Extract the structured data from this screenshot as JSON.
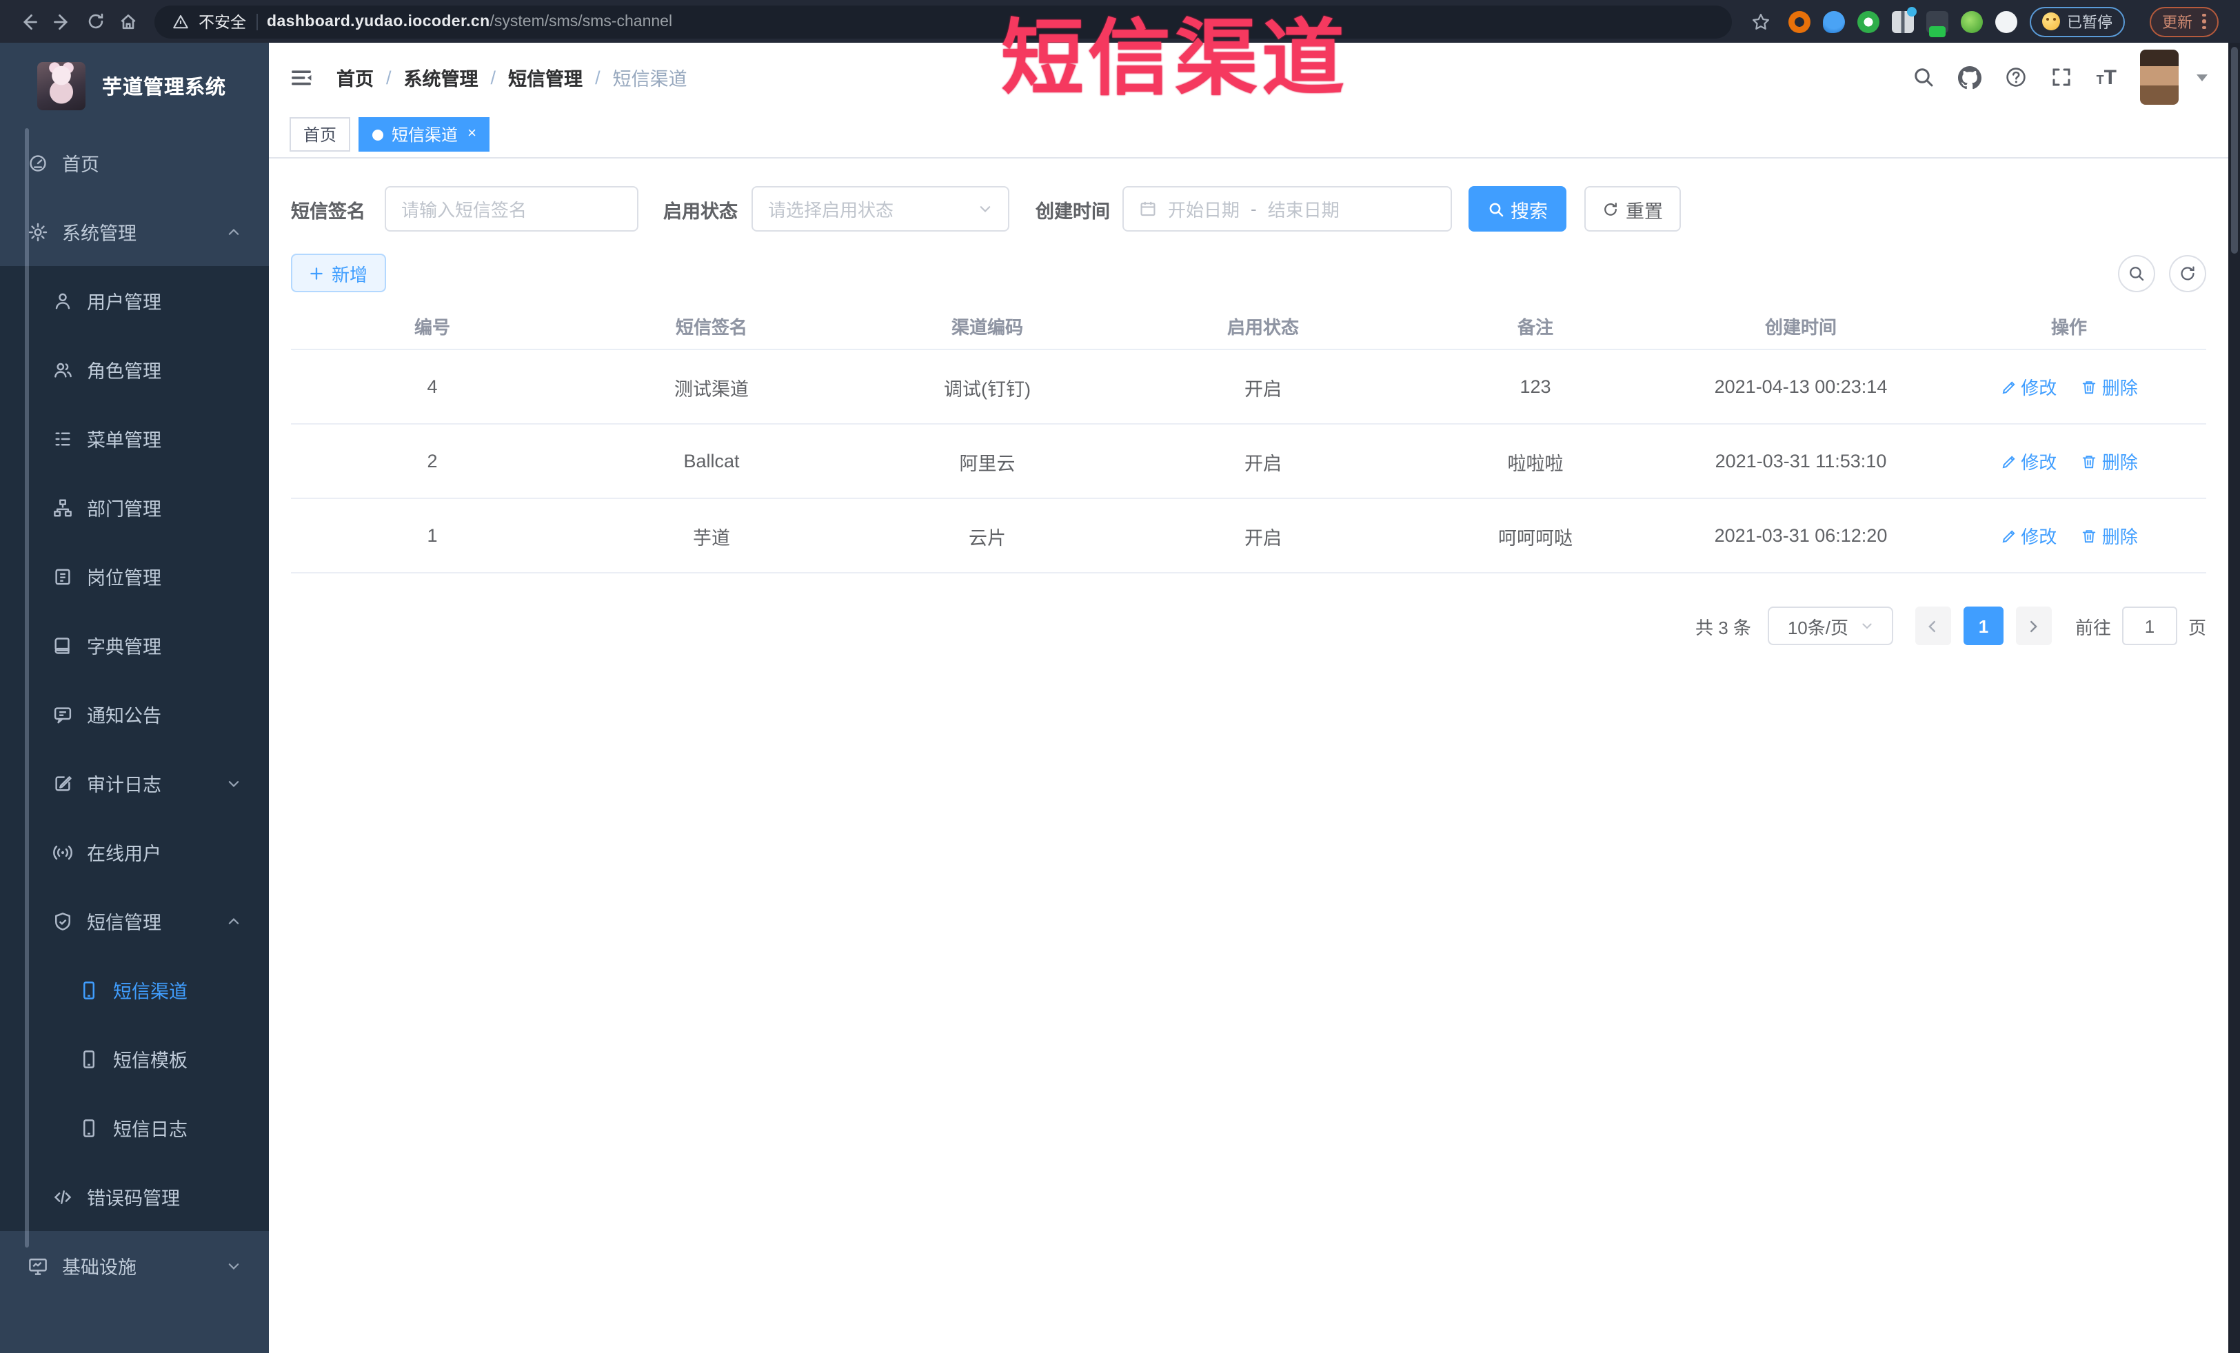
{
  "annotation": {
    "text": "短信渠道",
    "color": "#f5395f"
  },
  "browser": {
    "security_label": "不安全",
    "url_host": "dashboard.yudao.iocoder.cn",
    "url_path": "/system/sms/sms-channel",
    "paused_badge": "已暂停",
    "update_button": "更新"
  },
  "sidebar": {
    "title": "芋道管理系统",
    "items": [
      {
        "label": "首页"
      },
      {
        "label": "系统管理"
      },
      {
        "label": "用户管理"
      },
      {
        "label": "角色管理"
      },
      {
        "label": "菜单管理"
      },
      {
        "label": "部门管理"
      },
      {
        "label": "岗位管理"
      },
      {
        "label": "字典管理"
      },
      {
        "label": "通知公告"
      },
      {
        "label": "审计日志"
      },
      {
        "label": "在线用户"
      },
      {
        "label": "短信管理"
      },
      {
        "label": "短信渠道"
      },
      {
        "label": "短信模板"
      },
      {
        "label": "短信日志"
      },
      {
        "label": "错误码管理"
      },
      {
        "label": "基础设施"
      }
    ]
  },
  "header": {
    "breadcrumb": [
      "首页",
      "系统管理",
      "短信管理",
      "短信渠道"
    ],
    "separator": "/"
  },
  "tabs": [
    {
      "label": "首页"
    },
    {
      "label": "短信渠道",
      "close": "×"
    }
  ],
  "filters": {
    "sign_label": "短信签名",
    "sign_placeholder": "请输入短信签名",
    "status_label": "启用状态",
    "status_placeholder": "请选择启用状态",
    "time_label": "创建时间",
    "start_placeholder": "开始日期",
    "range_separator": "-",
    "end_placeholder": "结束日期",
    "search_label": "搜索",
    "reset_label": "重置"
  },
  "toolbar": {
    "add_label": "新增"
  },
  "table": {
    "columns": [
      "编号",
      "短信签名",
      "渠道编码",
      "启用状态",
      "备注",
      "创建时间",
      "操作"
    ],
    "edit_label": "修改",
    "delete_label": "删除",
    "rows": [
      {
        "id": "4",
        "sign": "测试渠道",
        "code": "调试(钉钉)",
        "status": "开启",
        "remark": "123",
        "time": "2021-04-13 00:23:14"
      },
      {
        "id": "2",
        "sign": "Ballcat",
        "code": "阿里云",
        "status": "开启",
        "remark": "啦啦啦",
        "time": "2021-03-31 11:53:10"
      },
      {
        "id": "1",
        "sign": "芋道",
        "code": "云片",
        "status": "开启",
        "remark": "呵呵呵哒",
        "time": "2021-03-31 06:12:20"
      }
    ]
  },
  "pagination": {
    "total": "共 3 条",
    "page_size": "10条/页",
    "current_page": "1",
    "goto_label": "前往",
    "goto_value": "1",
    "page_unit": "页"
  },
  "colors": {
    "accent": "#409eff",
    "sidebar_bg": "#304156",
    "submenu_bg": "#1f2d3d"
  }
}
